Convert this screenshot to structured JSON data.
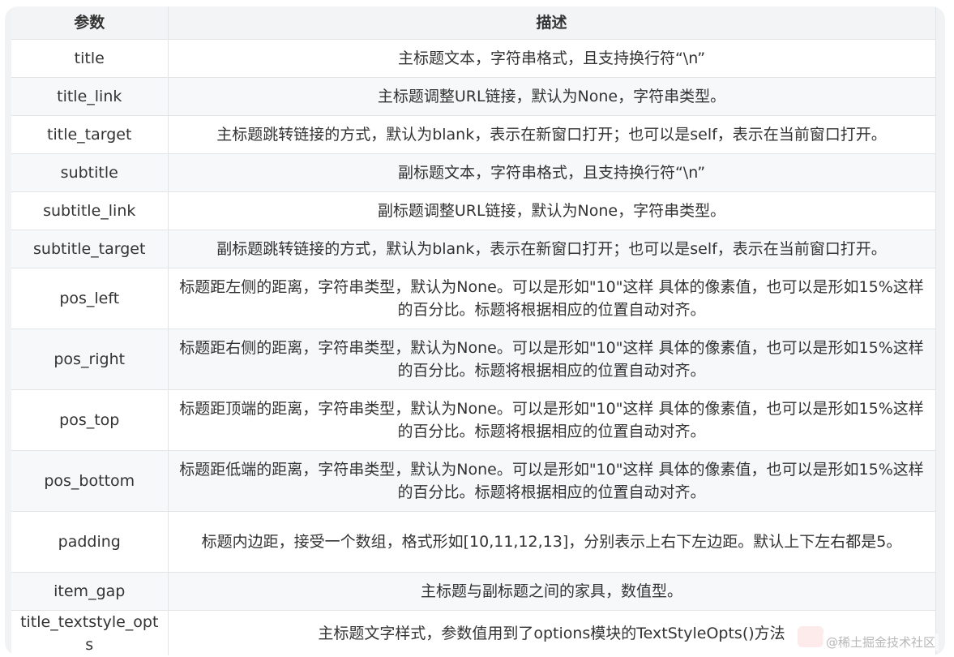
{
  "table": {
    "headers": [
      "参数",
      "描述"
    ],
    "rows": [
      {
        "param": "title",
        "desc": "主标题文本，字符串格式，且支持换行符“\\n”",
        "tall": false
      },
      {
        "param": "title_link",
        "desc": "主标题调整URL链接，默认为None，字符串类型。",
        "tall": false
      },
      {
        "param": "title_target",
        "desc": "主标题跳转链接的方式，默认为blank，表示在新窗口打开；也可以是self，表示在当前窗口打开。",
        "tall": false
      },
      {
        "param": "subtitle",
        "desc": "副标题文本，字符串格式，且支持换行符“\\n”",
        "tall": false
      },
      {
        "param": "subtitle_link",
        "desc": "副标题调整URL链接，默认为None，字符串类型。",
        "tall": false
      },
      {
        "param": "subtitle_target",
        "desc": "副标题跳转链接的方式，默认为blank，表示在新窗口打开；也可以是self，表示在当前窗口打开。",
        "tall": false
      },
      {
        "param": "pos_left",
        "desc": "标题距左侧的距离，字符串类型，默认为None。可以是形如\"10\"这样 具体的像素值，也可以是形如15%这样的百分比。标题将根据相应的位置自动对齐。",
        "tall": true
      },
      {
        "param": "pos_right",
        "desc": "标题距右侧的距离，字符串类型，默认为None。可以是形如\"10\"这样 具体的像素值，也可以是形如15%这样的百分比。标题将根据相应的位置自动对齐。",
        "tall": true
      },
      {
        "param": "pos_top",
        "desc": "标题距顶端的距离，字符串类型，默认为None。可以是形如\"10\"这样 具体的像素值，也可以是形如15%这样的百分比。标题将根据相应的位置自动对齐。",
        "tall": true
      },
      {
        "param": "pos_bottom",
        "desc": "标题距低端的距离，字符串类型，默认为None。可以是形如\"10\"这样 具体的像素值，也可以是形如15%这样的百分比。标题将根据相应的位置自动对齐。",
        "tall": true
      },
      {
        "param": "padding",
        "desc": "标题内边距，接受一个数组，格式形如[10,11,12,13]，分别表示上右下左边距。默认上下左右都是5。",
        "tall": true
      },
      {
        "param": "item_gap",
        "desc": "主标题与副标题之间的家具，数值型。",
        "tall": false
      },
      {
        "param": "title_textstyle_opts",
        "desc": "主标题文字样式，参数值用到了options模块的TextStyleOpts()方法",
        "tall": false
      }
    ]
  },
  "watermark": "@稀土掘金技术社区"
}
